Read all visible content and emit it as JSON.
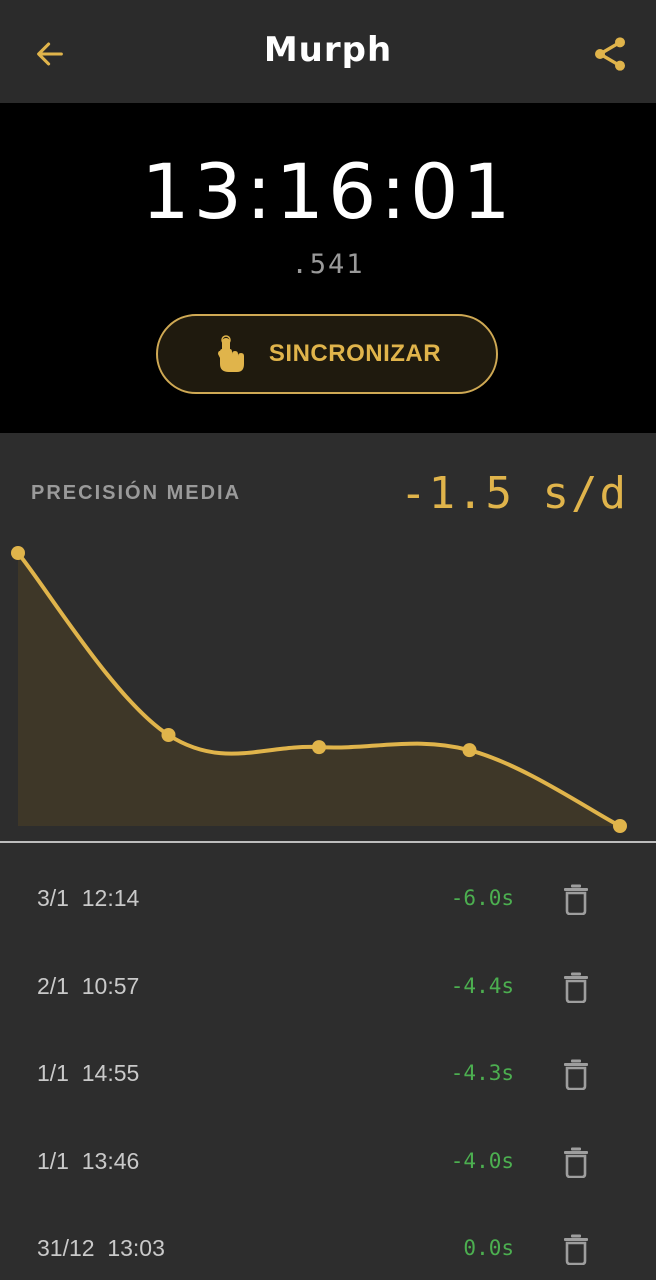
{
  "appbar": {
    "title": "Murph",
    "back_icon": "arrow-left-icon",
    "share_icon": "share-icon",
    "accent": "#e0b44b"
  },
  "clock": {
    "time": "13:16:01",
    "milliseconds": ".541",
    "sync_label": "SINCRONIZAR",
    "sync_icon": "hand-pointer-icon"
  },
  "precision": {
    "label": "PRECISIÓN MEDIA",
    "value": "-1.5 s/d"
  },
  "chart_data": {
    "type": "area",
    "title": "",
    "xlabel": "",
    "ylabel": "",
    "x": [
      1,
      2,
      3,
      4,
      5
    ],
    "values": [
      0,
      -6.0,
      -6.4,
      -6.5,
      -9.0
    ],
    "ylim": [
      -9.0,
      0
    ],
    "grid": false,
    "legend": "none",
    "line_color": "#e0b44b",
    "fill_color": "#3e3728"
  },
  "entries": [
    {
      "date": "3/1  12:14",
      "delta": "-6.0s"
    },
    {
      "date": "2/1  10:57",
      "delta": "-4.4s"
    },
    {
      "date": "1/1  14:55",
      "delta": "-4.3s"
    },
    {
      "date": "1/1  13:46",
      "delta": "-4.0s"
    },
    {
      "date": "31/12  13:03",
      "delta": "0.0s"
    }
  ]
}
